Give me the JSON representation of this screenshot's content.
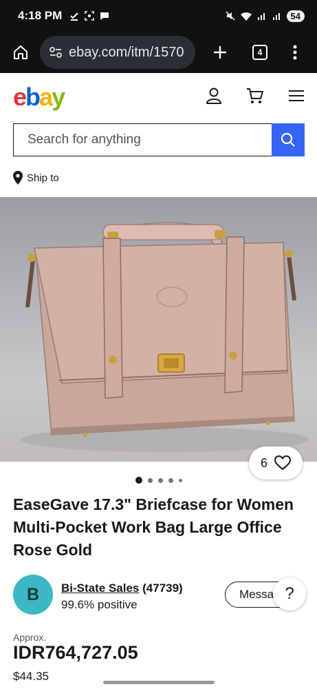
{
  "status_bar": {
    "time": "4:18 PM",
    "battery": "54"
  },
  "browser": {
    "url": "ebay.com/itm/1570",
    "tab_count": "4"
  },
  "header": {
    "logo": {
      "e": "e",
      "b": "b",
      "a": "a",
      "y": "y"
    }
  },
  "search": {
    "placeholder": "Search for anything"
  },
  "ship_to": {
    "label": "Ship to"
  },
  "product": {
    "watch_count": "6",
    "carousel_count": 5,
    "carousel_active": 0,
    "title": "EaseGave 17.3\" Briefcase for Women Multi-Pocket Work Bag Large Office Rose Gold"
  },
  "seller": {
    "initial": "B",
    "name": "Bi-State Sales",
    "feedback_count": "(47739)",
    "positive": "99.6% positive",
    "message_label": "Message",
    "help_label": "?"
  },
  "price": {
    "approx_label": "Approx.",
    "local": "IDR764,727.05",
    "usd": "$44.35"
  },
  "colors": {
    "accent_blue": "#3665f3",
    "avatar_teal": "#3cb8c4",
    "bag_pink": "#c9a79b"
  }
}
